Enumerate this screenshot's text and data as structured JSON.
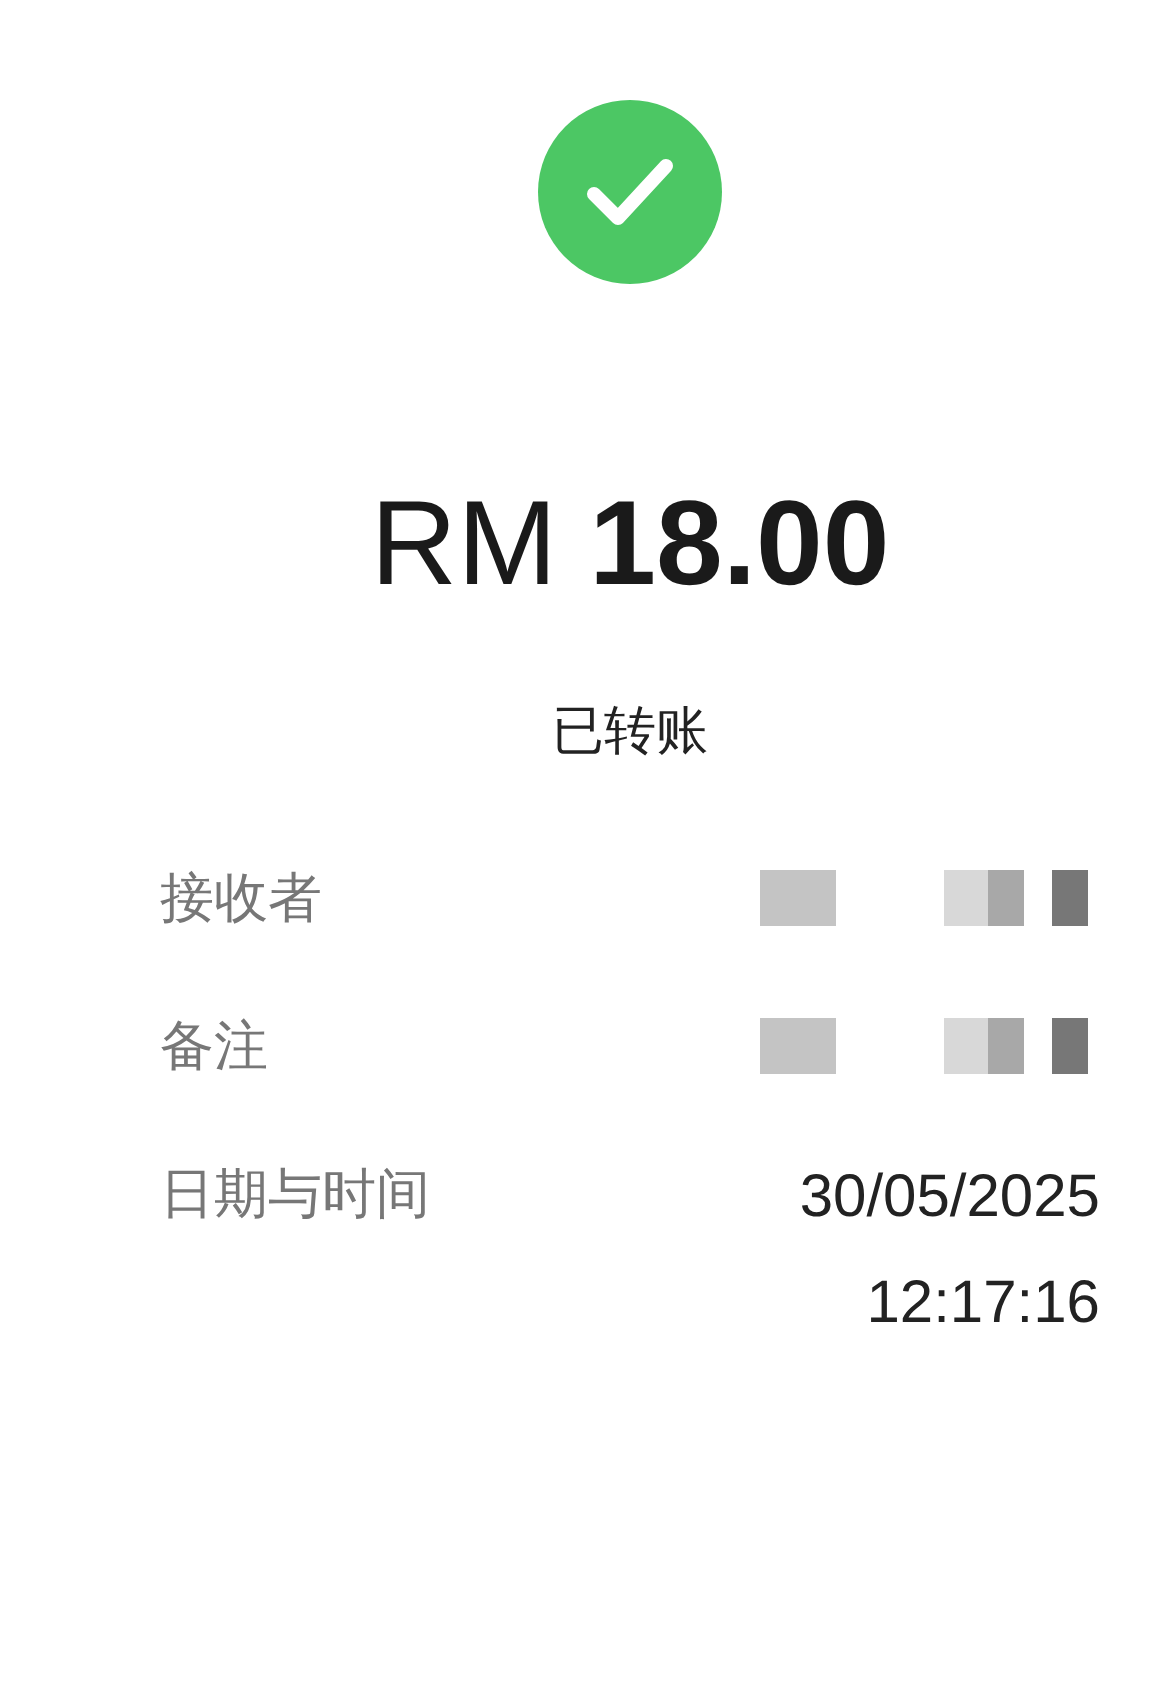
{
  "status": {
    "kind": "success"
  },
  "amount": {
    "currency": "RM",
    "value": "18.00"
  },
  "status_text": "已转账",
  "details": [
    {
      "label": "接收者",
      "kind": "redacted"
    },
    {
      "label": "备注",
      "kind": "redacted"
    },
    {
      "label": "日期与时间",
      "kind": "text",
      "lines": [
        "30/05/2025",
        "12:17:16"
      ]
    }
  ]
}
